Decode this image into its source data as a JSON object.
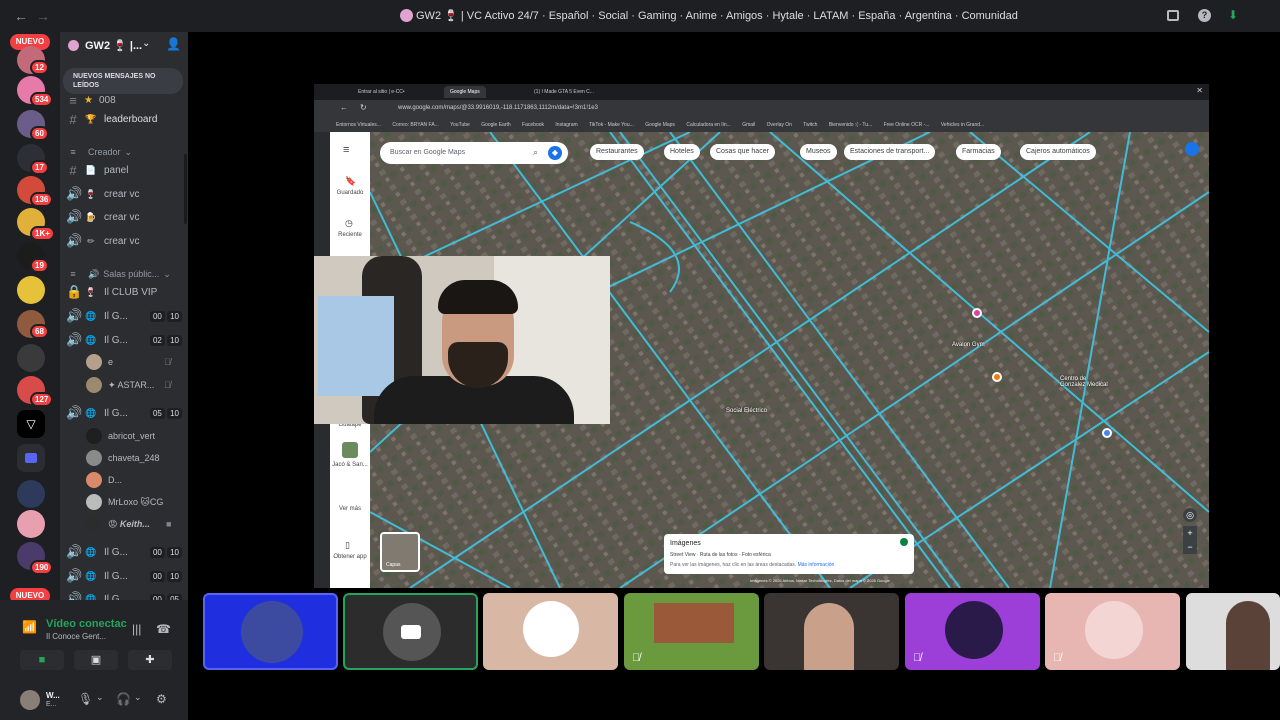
{
  "window": {
    "back_glyph": "←",
    "forward_glyph": "→",
    "title": "GW2 🍷 | VC Activo 24/7 · Español · Social · Gaming · Anime · Amigos · Hytale · LATAM · España · Argentina · Comunidad"
  },
  "guilds": {
    "nuevo_top": "NUEVO",
    "nuevo_bottom": "NUEVO",
    "badges": [
      "12",
      "534",
      "60",
      "17",
      "136",
      "1K+",
      "19",
      "68",
      "127",
      "190"
    ]
  },
  "server": {
    "name": "GW2 🍷 |...",
    "new_messages_banner": "NUEVOS MENSAJES NO LEÍDOS",
    "partial_channel": "008",
    "channels": [
      {
        "kind": "text",
        "icon": "🏆",
        "label": "leaderboard"
      },
      {
        "kind": "category",
        "label": "Creador"
      },
      {
        "kind": "text",
        "icon": "📄",
        "label": "panel"
      },
      {
        "kind": "voice",
        "icon": "🍷",
        "label": "crear vc"
      },
      {
        "kind": "voice",
        "icon": "🍺",
        "label": "crear vc"
      },
      {
        "kind": "voice",
        "icon": "✏",
        "label": "crear vc"
      },
      {
        "kind": "category",
        "label": "Salas públic..."
      },
      {
        "kind": "locked",
        "icon": "🍷",
        "label": "Il CLUB VIP"
      },
      {
        "kind": "voice",
        "icon": "🌐",
        "label": "Il G...",
        "count_a": "00",
        "count_b": "10"
      },
      {
        "kind": "voice",
        "icon": "🌐",
        "label": "Il G...",
        "count_a": "02",
        "count_b": "10"
      },
      {
        "kind": "voice",
        "icon": "🌐",
        "label": "Il G...",
        "count_a": "05",
        "count_b": "10"
      },
      {
        "kind": "voice",
        "icon": "🌐",
        "label": "Il G...",
        "count_a": "00",
        "count_b": "10"
      },
      {
        "kind": "voice",
        "icon": "🌐",
        "label": "Il G...",
        "count_a": "00",
        "count_b": "10"
      },
      {
        "kind": "voice",
        "icon": "🌐",
        "label": "Il G...",
        "count_a": "00",
        "count_b": "05"
      }
    ],
    "voice_users_a": [
      "e",
      "✦ ASTAR..."
    ],
    "voice_users_b": [
      "abricot_vert",
      "chaveta_248",
      "D...",
      "MrLoxo 🐱CG",
      "😡 Keith..."
    ]
  },
  "voice_panel": {
    "status": "Vídeo conectac",
    "channel": "Il Conoce Gent...",
    "user_name": "W...",
    "user_status": "E..."
  },
  "browser": {
    "tabs": [
      "Entrar al sitio | e-CC•",
      "Google Maps",
      "(1) I Made GTA 5 Even C..."
    ],
    "url": "www.google.com/maps/@33.9916019,-118.1171863,1112m/data=!3m1!1e3",
    "bookmarks": [
      "Entornos Virtuales...",
      "Correo: BRYAN FA...",
      "YouTube",
      "Google Earth",
      "Facebook",
      "Instagram",
      "TikTok - Make You...",
      "Google Maps",
      "Calculadora en lín...",
      "Gmail",
      "Overlay On",
      "Twitch",
      "Bienvenido :( - Tu...",
      "Free Online OCR -...",
      "Vehicles in Grand..."
    ],
    "search_placeholder": "Buscar en Google Maps",
    "chips": [
      "Restaurantes",
      "Hoteles",
      "Cosas que hacer",
      "Museos",
      "Estaciones de transport...",
      "Farmacias",
      "Cajeros automáticos"
    ],
    "side_labels": [
      "Guardado",
      "Reciente",
      "Guatape",
      "Jacó & San...",
      "Ver más",
      "Obtener app"
    ],
    "map_labels": [
      "Social Eléctrico",
      "Avalon Gym",
      "Centro de Gonzalez Medical"
    ],
    "images_card": {
      "title": "Imágenes",
      "options": "Street View · Ruta de las fotos · Foto esférica",
      "hint": "Para ver las imágenes, haz clic en las áreas destacadas.",
      "more": "Más información"
    },
    "layers_label": "Capas",
    "attribution": "Imágenes © 2026 Airbus, Maxar Technologies, Datos del mapa © 2026 Google"
  },
  "colors": {
    "discord_bg": "#2b2d31",
    "discord_dark": "#1e1f22",
    "green": "#23a55a",
    "red": "#f23f42",
    "road": "#3fc7e6"
  }
}
